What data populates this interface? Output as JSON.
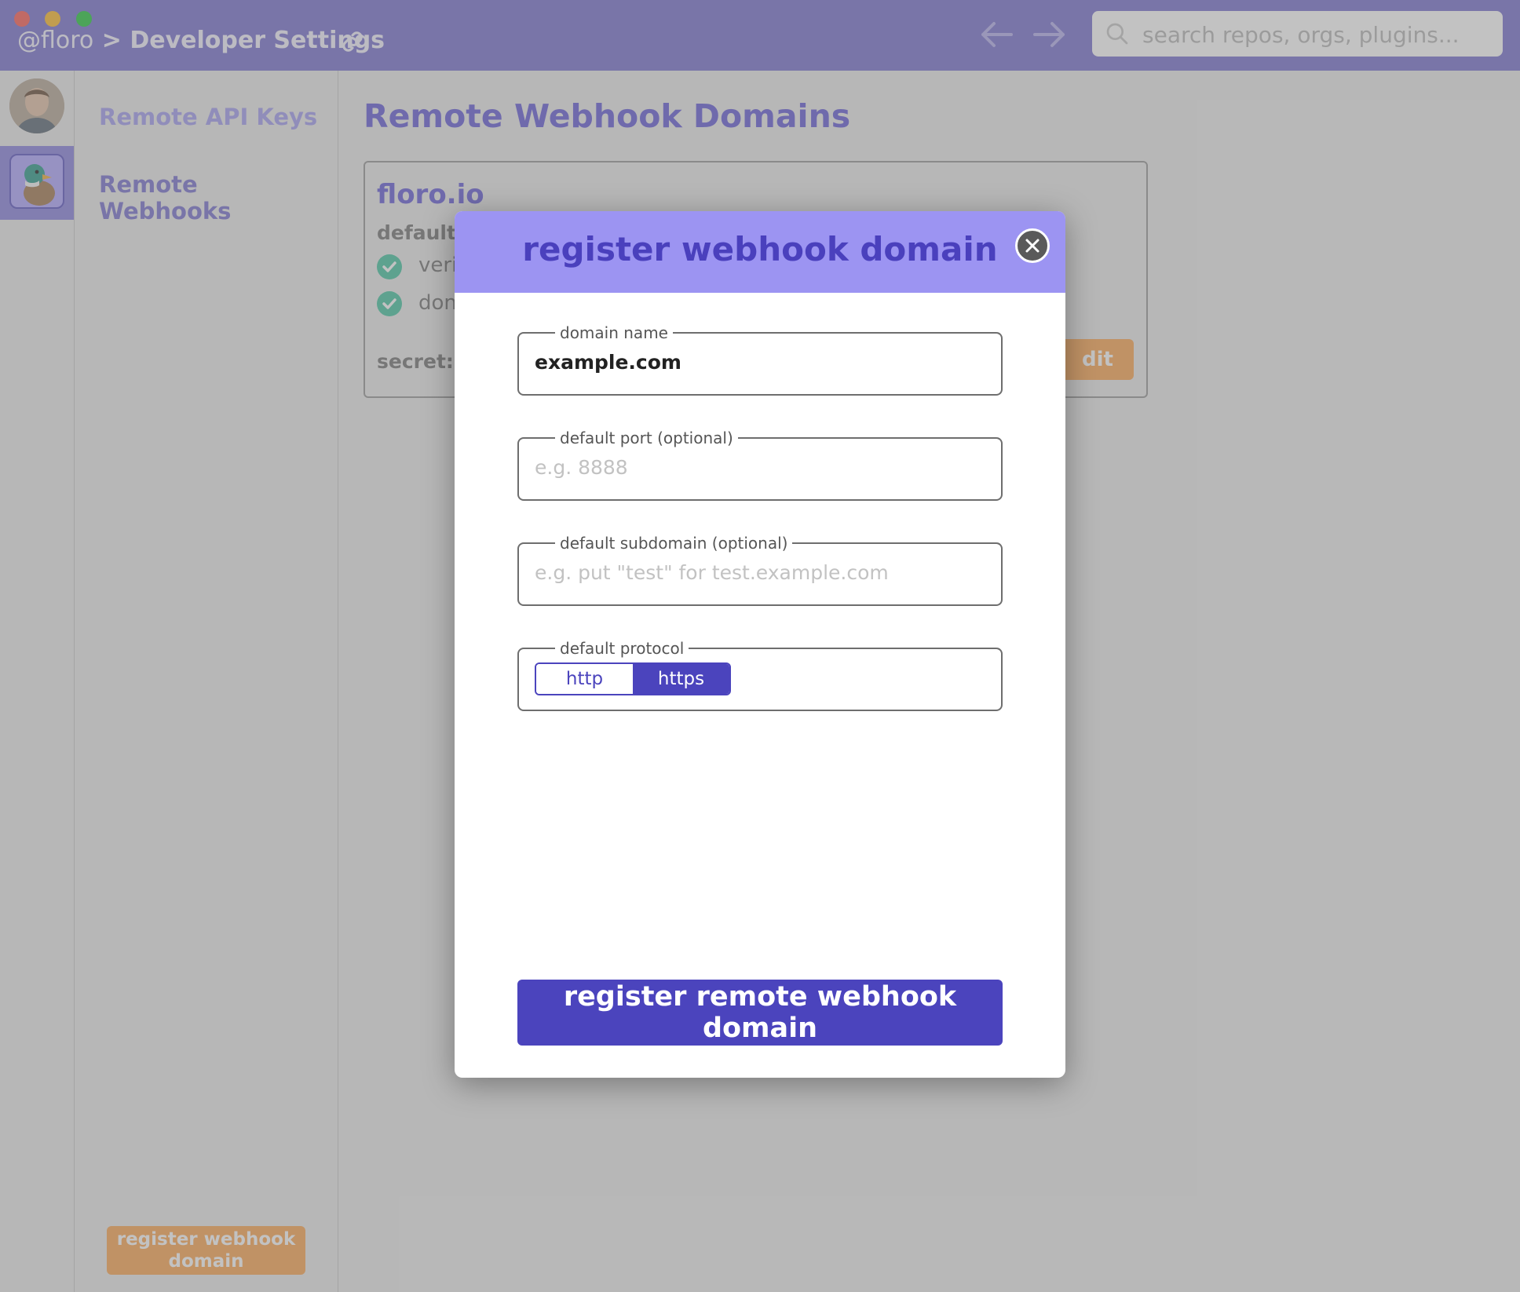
{
  "window": {
    "breadcrumb_user": "@floro",
    "breadcrumb_sep": ">",
    "breadcrumb_page": "Developer Settings",
    "traffic_lights": {
      "close": "#fe5f57",
      "minimize": "#febc2e",
      "maximize": "#28c840"
    }
  },
  "search": {
    "placeholder": "search repos, orgs, plugins..."
  },
  "sidebar": {
    "items": [
      {
        "label": "Remote API Keys"
      },
      {
        "label": "Remote Webhooks"
      }
    ],
    "register_button": "register webhook domain"
  },
  "main": {
    "title": "Remote Webhook Domains",
    "card": {
      "domain": "floro.io",
      "default_label": "default:",
      "check_1_text": "veri",
      "check_2_text": "don",
      "secret_label": "secret:",
      "edit_label": "dit"
    }
  },
  "modal": {
    "title": "register webhook domain",
    "fields": {
      "domain_name": {
        "label": "domain name",
        "value": "example.com"
      },
      "port": {
        "label": "default port (optional)",
        "placeholder": "e.g. 8888"
      },
      "subdomain": {
        "label": "default subdomain (optional)",
        "placeholder": "e.g. put \"test\" for test.example.com"
      },
      "protocol": {
        "label": "default protocol",
        "options": [
          "http",
          "https"
        ],
        "selected": "https"
      }
    },
    "submit_label": "register remote webhook domain"
  },
  "colors": {
    "brand_purple": "#4b44bd",
    "header_purple": "#9c94f2",
    "titlebar": "#7a73cf",
    "orange": "#fba857",
    "teal_check": "#49c5a3"
  }
}
